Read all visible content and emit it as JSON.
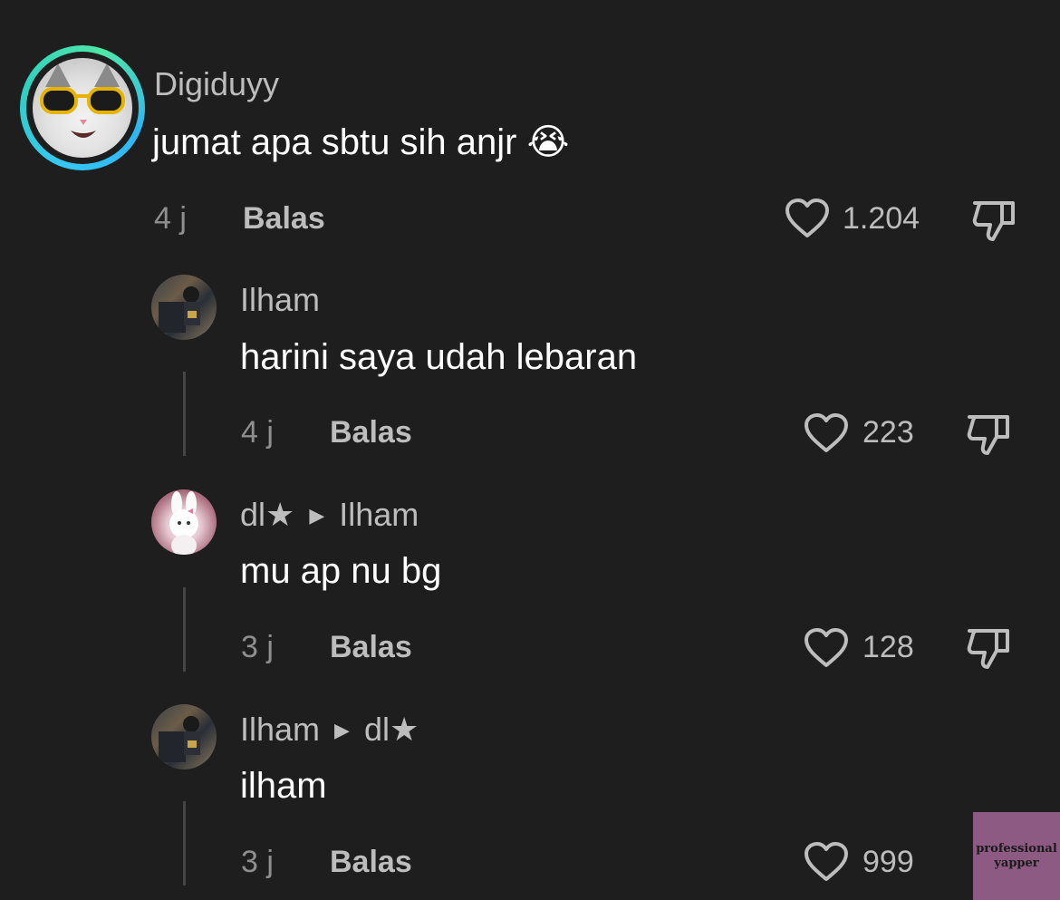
{
  "comment": {
    "username": "Digiduyy",
    "text": "jumat apa sbtu sih anjr",
    "emoji": "😭",
    "time": "4 j",
    "reply_label": "Balas",
    "likes": "1.204"
  },
  "replies": [
    {
      "username": "Ilham",
      "reply_to": "",
      "text": "harini saya udah lebaran",
      "time": "4 j",
      "reply_label": "Balas",
      "likes": "223"
    },
    {
      "username": "dl★",
      "reply_to": "Ilham",
      "text": "mu ap nu bg",
      "time": "3 j",
      "reply_label": "Balas",
      "likes": "128"
    },
    {
      "username": "Ilham",
      "reply_to": "dl★",
      "text": "ilham",
      "time": "3 j",
      "reply_label": "Balas",
      "likes": "999"
    }
  ],
  "watermark": {
    "line1": "professional",
    "line2": "yapper"
  },
  "icons": {
    "like": "heart-outline-icon",
    "dislike": "thumbs-down-outline-icon",
    "reply_arrow": "caret-right-icon"
  },
  "colors": {
    "background": "#1e1e1e",
    "avatar_ring": "#36c6f4",
    "muted_text": "#8f8f8f"
  }
}
